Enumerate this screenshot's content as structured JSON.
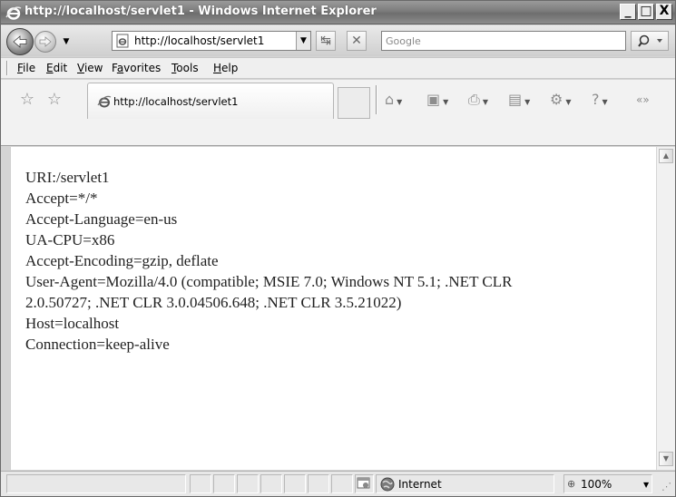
{
  "window": {
    "title": "http://localhost/servlet1 - Windows Internet Explorer",
    "buttons": {
      "minimize": "_",
      "maximize": "□",
      "close": "X"
    }
  },
  "navbar": {
    "address": "http://localhost/servlet1",
    "search_placeholder": "Google"
  },
  "menubar": {
    "items": [
      {
        "prefix": "",
        "key": "F",
        "rest": "ile"
      },
      {
        "prefix": "",
        "key": "E",
        "rest": "dit"
      },
      {
        "prefix": "",
        "key": "V",
        "rest": "iew"
      },
      {
        "prefix": "F",
        "key": "a",
        "rest": "vorites"
      },
      {
        "prefix": "",
        "key": "T",
        "rest": "ools"
      },
      {
        "prefix": "",
        "key": "H",
        "rest": "elp"
      }
    ]
  },
  "tab": {
    "title": "http://localhost/servlet1"
  },
  "content": {
    "lines": [
      "URI:/servlet1",
      "Accept=*/*",
      "Accept-Language=en-us",
      "UA-CPU=x86",
      "Accept-Encoding=gzip, deflate",
      "User-Agent=Mozilla/4.0 (compatible; MSIE 7.0; Windows NT 5.1; .NET CLR",
      "2.0.50727; .NET CLR 3.0.04506.648; .NET CLR 3.5.21022)",
      "Host=localhost",
      "Connection=keep-alive"
    ]
  },
  "status": {
    "zone": "Internet",
    "zoom": "100%"
  }
}
